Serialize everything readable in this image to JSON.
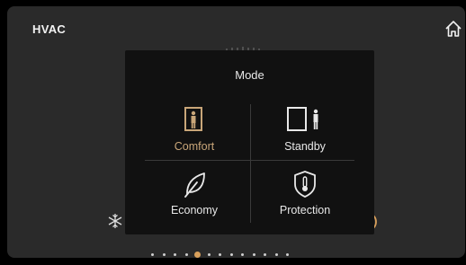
{
  "header": {
    "title": "HVAC",
    "home_icon": "home-icon"
  },
  "modal": {
    "title": "Mode",
    "options": [
      {
        "label": "Comfort",
        "icon": "person-in-door-icon",
        "active": true
      },
      {
        "label": "Standby",
        "icon": "person-beside-door-icon",
        "active": false
      },
      {
        "label": "Economy",
        "icon": "leaf-icon",
        "active": false
      },
      {
        "label": "Protection",
        "icon": "shield-thermometer-icon",
        "active": false
      }
    ]
  },
  "pager": {
    "count": 13,
    "active_index": 4
  },
  "colors": {
    "accent": "#c9a679",
    "pager_active": "#d9a05b",
    "panel": "#2a2a2a",
    "modal": "#111111",
    "text": "#e8e8e8"
  }
}
